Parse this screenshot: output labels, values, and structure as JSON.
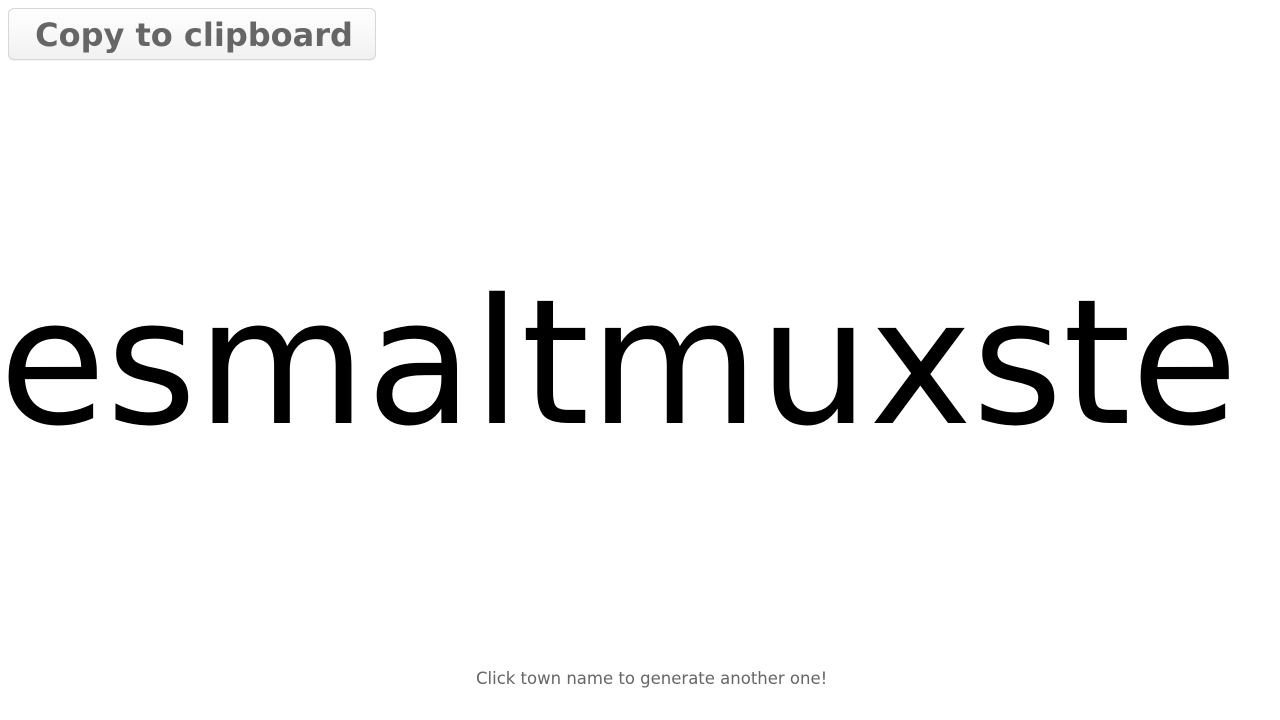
{
  "actions": {
    "copy_label": "Copy to clipboard"
  },
  "generator": {
    "town_name": "esmaltmuxste",
    "hint": "Click town name to generate another one!"
  }
}
